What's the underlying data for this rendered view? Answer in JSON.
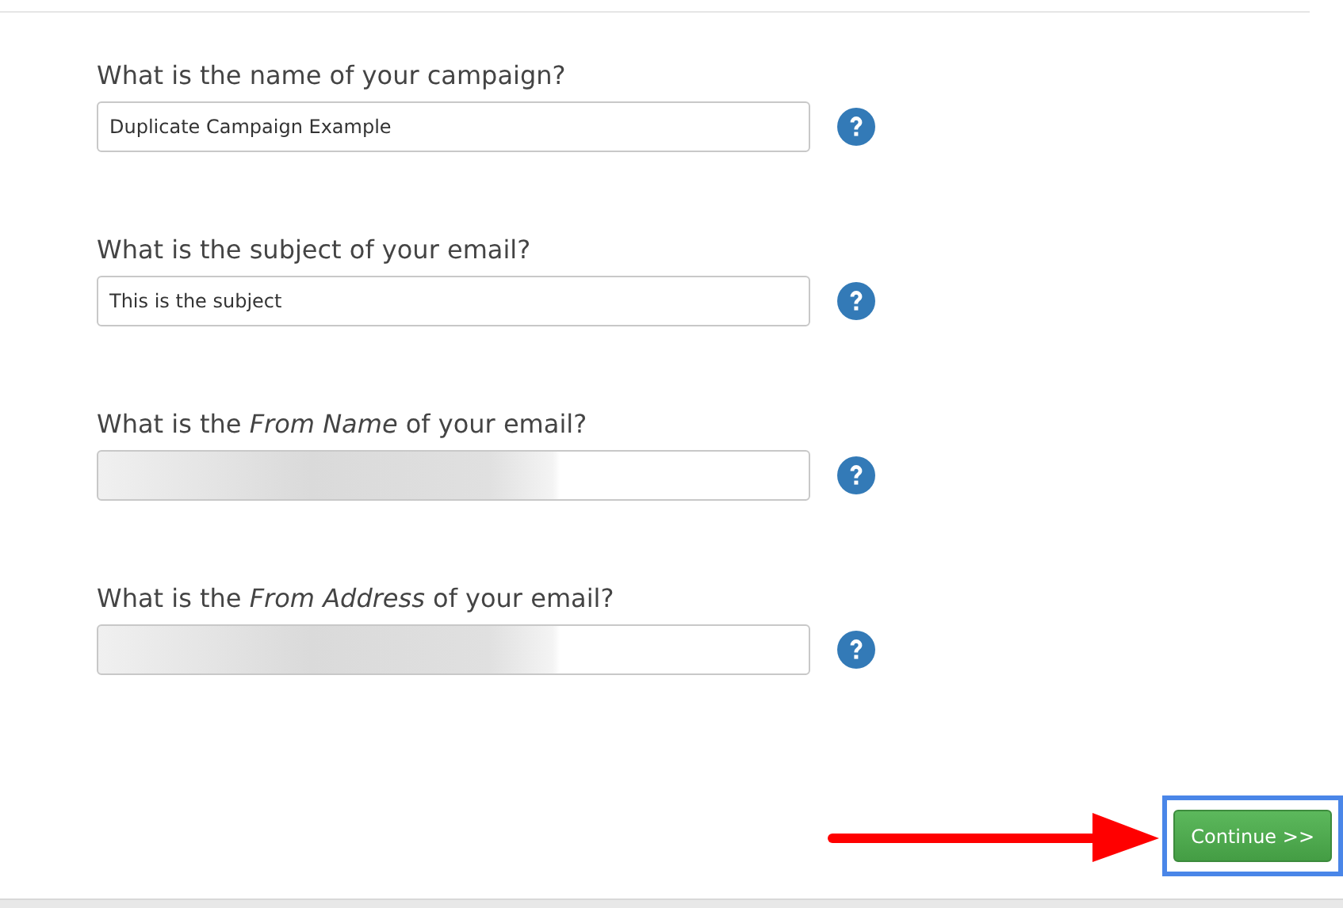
{
  "questions": [
    {
      "label": "What is the name of your campaign?",
      "value": "Duplicate Campaign Example",
      "redacted": false
    },
    {
      "label": "What is the subject of your email?",
      "value": "This is the subject",
      "redacted": false
    },
    {
      "label": "What is the *From Name* of your email?",
      "redacted": true
    },
    {
      "label": "What is the *From Address* of your email?",
      "redacted": true
    }
  ],
  "continue_button": {
    "label": "Continue >>",
    "highlighted": true,
    "pointer_arrow": true
  }
}
